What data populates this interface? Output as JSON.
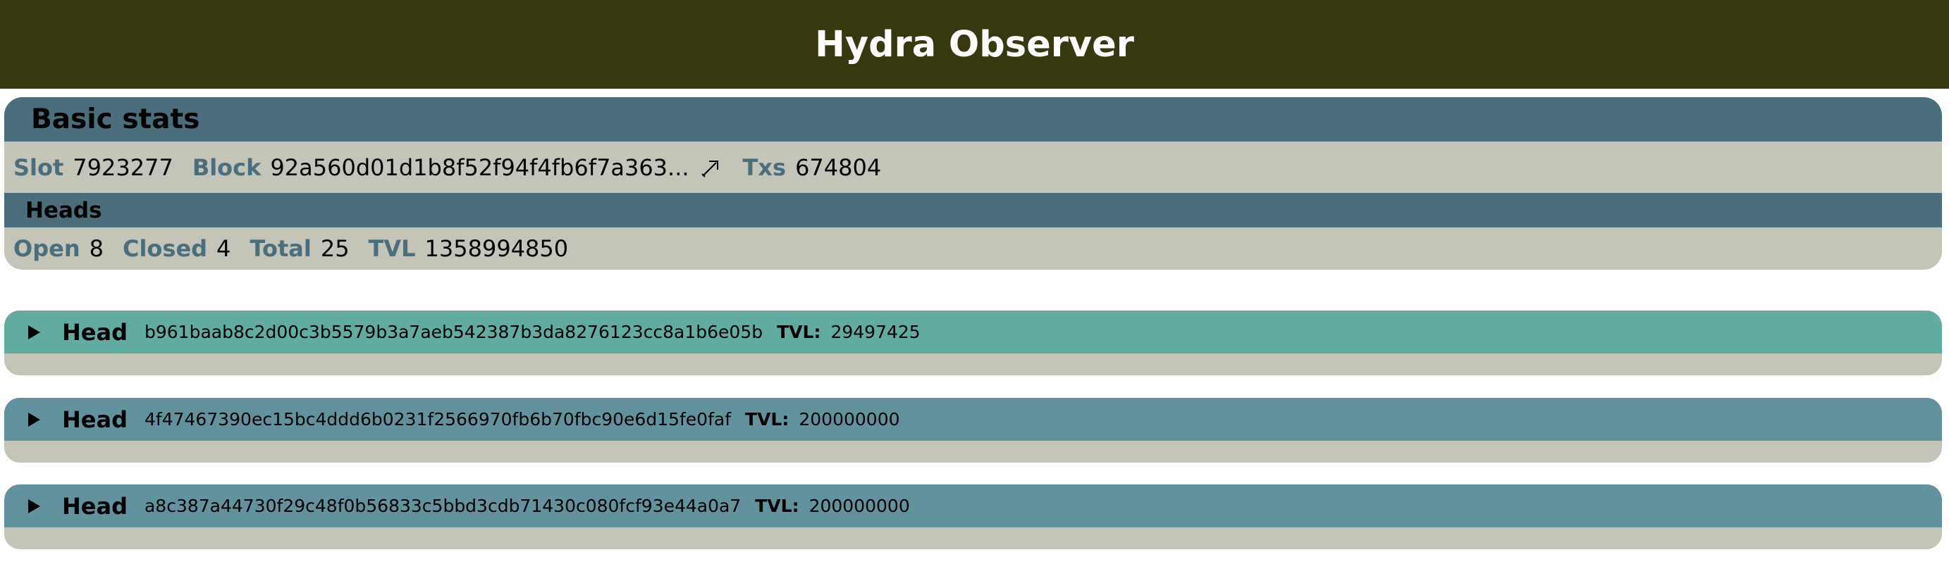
{
  "app": {
    "title": "Hydra Observer"
  },
  "basic_stats": {
    "title": "Basic stats",
    "slot_label": "Slot",
    "slot_value": "7923277",
    "block_label": "Block",
    "block_value": "92a560d01d1b8f52f94f4fb6f7a363...",
    "block_link_icon": "external-link-icon",
    "txs_label": "Txs",
    "txs_value": "674804"
  },
  "heads_summary": {
    "title": "Heads",
    "open_label": "Open",
    "open_value": "8",
    "closed_label": "Closed",
    "closed_value": "4",
    "total_label": "Total",
    "total_value": "25",
    "tvl_label": "TVL",
    "tvl_value": "1358994850"
  },
  "heads": [
    {
      "label": "Head",
      "id": "b961baab8c2d00c3b5579b3a7aeb542387b3da8276123cc8a1b6e05b",
      "tvl_label": "TVL:",
      "tvl": "29497425",
      "color": "#62aba0"
    },
    {
      "label": "Head",
      "id": "4f47467390ec15bc4ddd6b0231f2566970fb6b70fbc90e6d15fe0faf",
      "tvl_label": "TVL:",
      "tvl": "200000000",
      "color": "#62929e"
    },
    {
      "label": "Head",
      "id": "a8c387a44730f29c48f0b56833c5bbd3cdb71430c080fcf93e44a0a7",
      "tvl_label": "TVL:",
      "tvl": "200000000",
      "color": "#62929e"
    }
  ],
  "colors": {
    "header_bg": "#383810",
    "section_bar": "#4a6e7c",
    "panel_bg": "#c4c4b8",
    "head_active": "#62aba0",
    "head_default": "#62929e"
  }
}
